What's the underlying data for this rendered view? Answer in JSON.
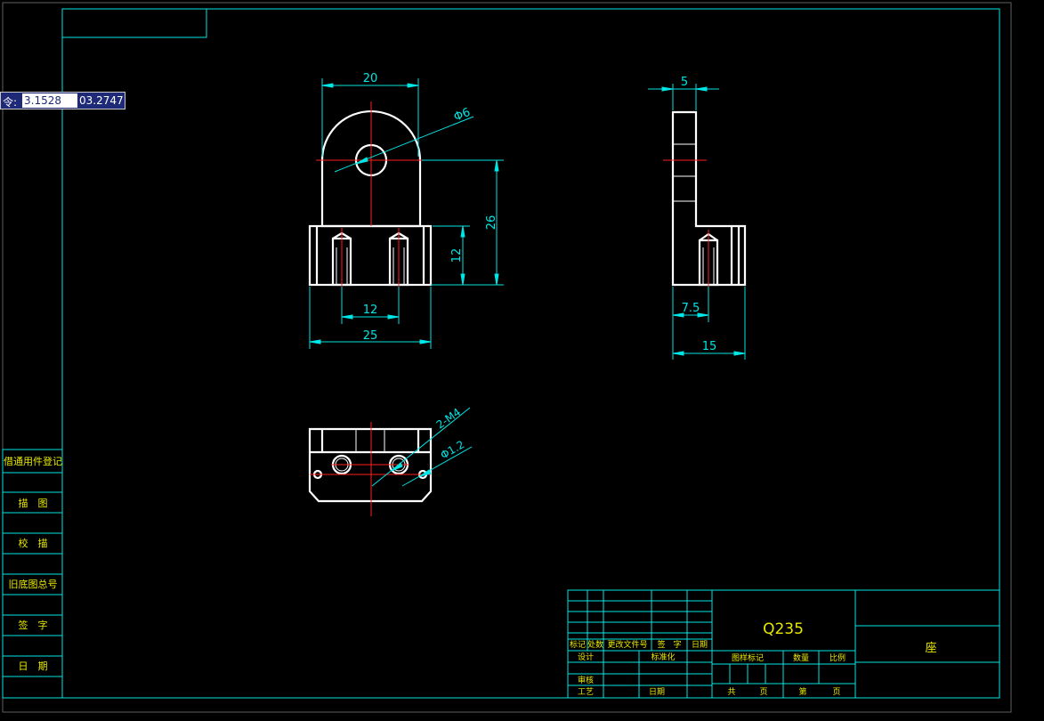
{
  "colors": {
    "background": "#000000",
    "frame": "#00e5e5",
    "outline": "#ffffff",
    "centerline": "#ff2020",
    "dimension": "#00e5e5",
    "text": "#e8e800"
  },
  "command_line": {
    "prompt": "令:",
    "x_value": "3.1528",
    "y_value": "03.2747"
  },
  "left_column": {
    "labels": [
      "借通用件登记",
      "描　图",
      "校　描",
      "旧底图总号",
      "签　字",
      "日　期"
    ]
  },
  "views": {
    "front": {
      "dim_width_top": "20",
      "dim_hole": "Φ6",
      "dim_height_total": "26",
      "dim_height_base": "12",
      "dim_hole_spacing": "12",
      "dim_width_base": "25"
    },
    "side": {
      "dim_thickness": "5",
      "dim_half": "7.5",
      "dim_depth": "15"
    },
    "top": {
      "dim_thread": "2-M4",
      "dim_hole": "Φ1.2"
    }
  },
  "title_block": {
    "material": "Q235",
    "part_name": "座",
    "rev_headers": [
      "标记",
      "处数",
      "更改文件号",
      "签　字",
      "日期"
    ],
    "sign_rows": [
      "设计",
      "标准化",
      "审核",
      "工艺",
      "日期"
    ],
    "info_headers": [
      "图样标记",
      "数量",
      "比例"
    ],
    "sheet_labels": [
      "共",
      "页",
      "第",
      "页"
    ]
  }
}
